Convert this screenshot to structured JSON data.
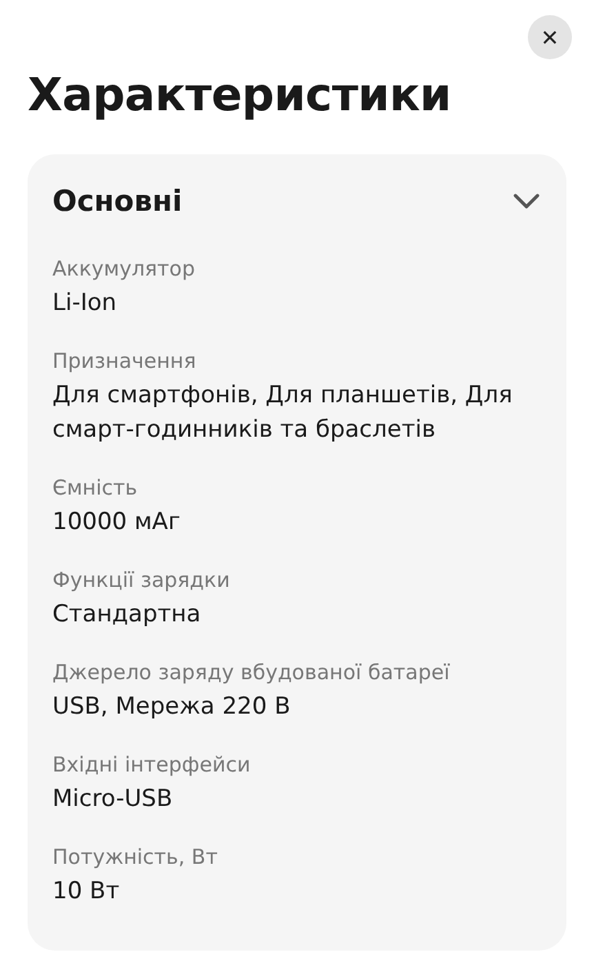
{
  "close_button": {
    "label": "✕"
  },
  "title": "Характеристики",
  "section": {
    "title": "Основні",
    "expanded": true,
    "specs": [
      {
        "label": "Аккумулятор",
        "value": "Li-Ion"
      },
      {
        "label": "Призначення",
        "value": "Для смартфонів, Для планшетів, Для смарт-годинників та браслетів"
      },
      {
        "label": "Ємність",
        "value": "10000 мАг"
      },
      {
        "label": "Функції зарядки",
        "value": "Стандартна"
      },
      {
        "label": "Джерело заряду вбудованої батареї",
        "value": "USB, Мережа 220 В"
      },
      {
        "label": "Вхідні інтерфейси",
        "value": "Micro-USB"
      },
      {
        "label": "Потужність, Вт",
        "value": "10 Вт"
      }
    ]
  }
}
